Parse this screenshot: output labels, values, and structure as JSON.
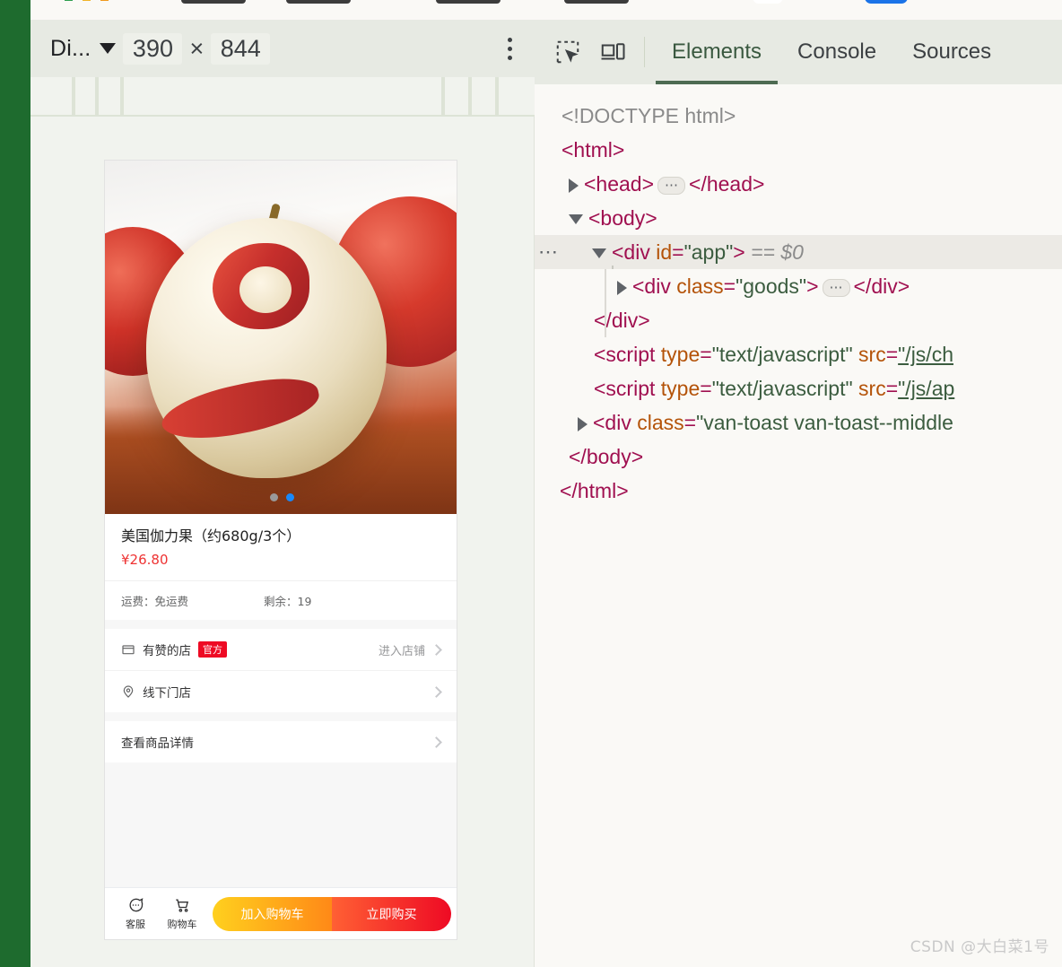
{
  "browser": {
    "chrome_strip_visible": true
  },
  "device_toolbar": {
    "device_label": "Di...",
    "device_caret_icon": "chevron-down-icon",
    "width": "390",
    "separator": "×",
    "height": "844",
    "more_icon": "kebab-menu-icon"
  },
  "devtools": {
    "inspect_icon": "inspect-element-icon",
    "device_toggle_icon": "device-toolbar-icon",
    "tabs": [
      {
        "label": "Elements",
        "active": true
      },
      {
        "label": "Console",
        "active": false
      },
      {
        "label": "Sources",
        "active": false
      }
    ],
    "dom_lines": [
      {
        "id": "doctype",
        "text": "<!DOCTYPE html>"
      },
      {
        "id": "html_open",
        "text": "<html>"
      },
      {
        "id": "head",
        "tag_open": "<head>",
        "tag_close": "</head>",
        "collapsed": true
      },
      {
        "id": "body_open",
        "text": "<body>"
      },
      {
        "id": "div_app",
        "tag": "<div",
        "attr": "id",
        "value": "\"app\"",
        "close": ">",
        "suffix": "== $0",
        "selected": true
      },
      {
        "id": "div_goods",
        "tag": "<div",
        "attr": "class",
        "value": "\"goods\"",
        "close": ">",
        "tag_close": "</div>",
        "collapsed": true
      },
      {
        "id": "div_close",
        "text": "</div>"
      },
      {
        "id": "script1",
        "tag": "<script",
        "attr1": "type",
        "value1": "\"text/javascript\"",
        "attr2": "src",
        "value2": "\"/js/ch"
      },
      {
        "id": "script2",
        "tag": "<script",
        "attr1": "type",
        "value1": "\"text/javascript\"",
        "attr2": "src",
        "value2": "\"/js/ap"
      },
      {
        "id": "div_toast",
        "tag": "<div",
        "attr": "class",
        "value": "\"van-toast van-toast--middle"
      },
      {
        "id": "body_close",
        "text": "</body>"
      },
      {
        "id": "html_close",
        "text": "</html>"
      }
    ]
  },
  "phone": {
    "gallery": {
      "image_alt": "peeled-apple-photo",
      "dots": [
        {
          "active": false
        },
        {
          "active": true
        }
      ]
    },
    "product": {
      "title": "美国伽力果（约680g/3个）",
      "price": "¥26.80",
      "shipping_label": "运费：免运费",
      "stock_label": "剩余：19"
    },
    "store": {
      "icon": "shop-icon",
      "name": "有赞的店",
      "badge": "官方",
      "enter_label": "进入店铺",
      "chevron_icon": "chevron-right-icon"
    },
    "offline_store": {
      "icon": "location-pin-icon",
      "label": "线下门店",
      "chevron_icon": "chevron-right-icon"
    },
    "detail_row": {
      "label": "查看商品详情",
      "chevron_icon": "chevron-right-icon"
    },
    "action_bar": {
      "service": {
        "icon": "chat-bubble-icon",
        "label": "客服"
      },
      "cart": {
        "icon": "shopping-cart-icon",
        "label": "购物车"
      },
      "add_to_cart_label": "加入购物车",
      "buy_now_label": "立即购买"
    }
  },
  "watermark": "CSDN @大白菜1号",
  "colors": {
    "rail_green": "#1e6b2e",
    "price_red": "#ee3333",
    "badge_red": "#ee0a24",
    "cart_gradient_from": "#ffd01e",
    "cart_gradient_to": "#ff8917",
    "buy_gradient_from": "#ff6034",
    "buy_gradient_to": "#ee0a24",
    "active_dot_blue": "#1989fa",
    "devtools_tab_active": "#4d6b52"
  }
}
